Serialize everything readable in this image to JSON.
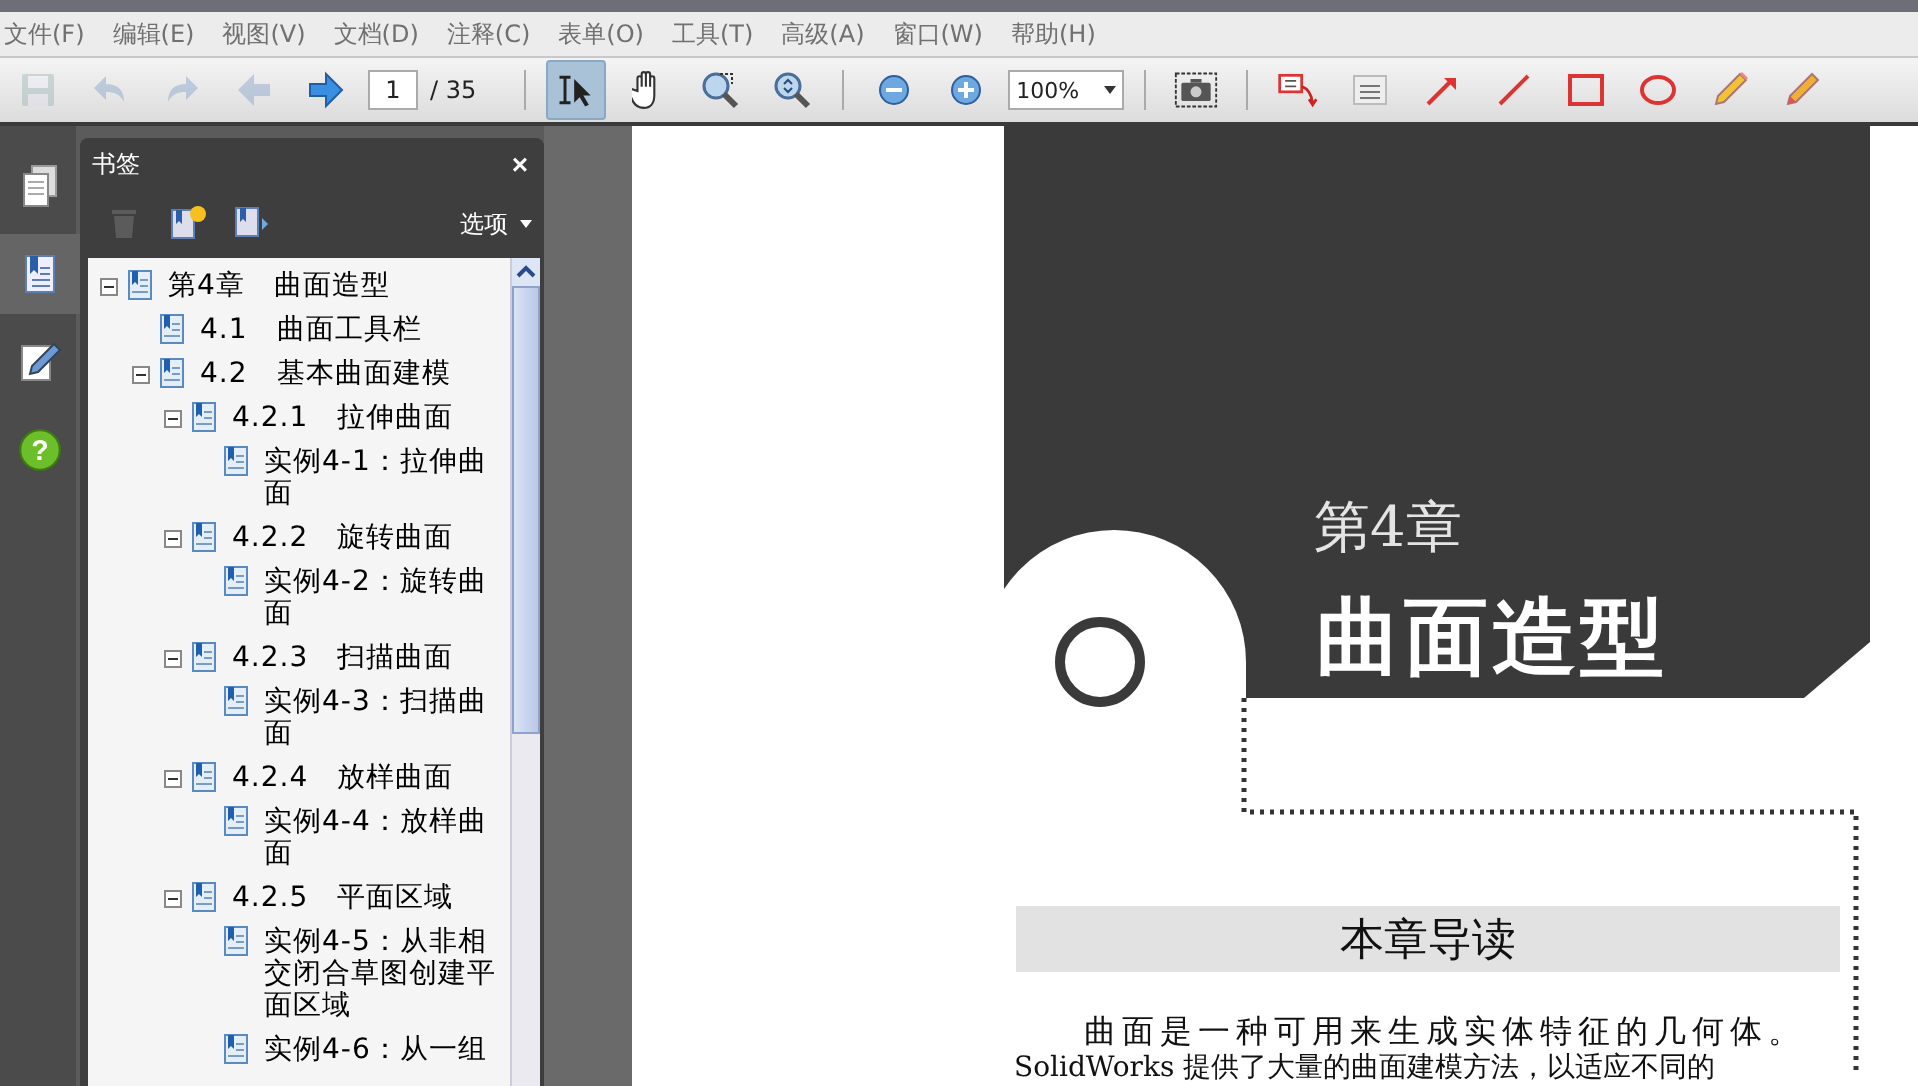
{
  "menu": [
    "文件(F)",
    "编辑(E)",
    "视图(V)",
    "文档(D)",
    "注释(C)",
    "表单(O)",
    "工具(T)",
    "高级(A)",
    "窗口(W)",
    "帮助(H)"
  ],
  "toolbar": {
    "groups": [
      [
        {
          "kind": "save",
          "disabled": true
        },
        {
          "kind": "undo",
          "disabled": true
        },
        {
          "kind": "redo",
          "disabled": true
        },
        {
          "kind": "previous",
          "disabled": true
        },
        {
          "kind": "next",
          "disabled": false
        },
        {
          "kind": "page",
          "value": "1",
          "total": "/ 35"
        }
      ],
      [
        {
          "kind": "select",
          "disabled": false,
          "selected": true
        },
        {
          "kind": "hand",
          "disabled": false,
          "selected": false
        },
        {
          "kind": "marquee",
          "disabled": false,
          "selected": false
        },
        {
          "kind": "zoom",
          "disabled": false,
          "selected": false
        }
      ],
      [
        {
          "kind": "zoomout",
          "disabled": false
        },
        {
          "kind": "zoomin",
          "disabled": false
        },
        {
          "kind": "zoomfield",
          "value": "100%"
        }
      ],
      [
        {
          "kind": "snapshot",
          "disabled": false
        }
      ],
      [
        {
          "kind": "callout",
          "disabled": false,
          "selected": false
        },
        {
          "kind": "textbox",
          "disabled": false,
          "selected": false
        },
        {
          "kind": "arrow",
          "disabled": false,
          "selected": false
        },
        {
          "kind": "line",
          "disabled": false,
          "selected": false
        },
        {
          "kind": "rect",
          "disabled": false,
          "selected": false
        },
        {
          "kind": "ellipse",
          "disabled": false,
          "selected": false
        },
        {
          "kind": "pencil",
          "disabled": false,
          "selected": false
        },
        {
          "kind": "eraser",
          "disabled": false,
          "selected": false
        }
      ]
    ]
  },
  "nav_tabs": [
    {
      "kind": "pages",
      "selected": false
    },
    {
      "kind": "bookmarks",
      "selected": true
    },
    {
      "kind": "sign",
      "selected": false
    },
    {
      "kind": "help",
      "selected": false,
      "symbol": "?"
    }
  ],
  "bookmarks": {
    "title": "书签",
    "close": "×",
    "tools": [
      {
        "kind": "delete",
        "disabled": true
      },
      {
        "kind": "new",
        "disabled": false
      },
      {
        "kind": "expand",
        "disabled": false
      }
    ],
    "options": "选项",
    "tree": [
      {
        "label": "第4章　曲面造型",
        "expanded": true,
        "children": [
          {
            "label": "4.1　曲面工具栏"
          },
          {
            "label": "4.2　基本曲面建模",
            "expanded": true,
            "children": [
              {
                "label": "4.2.1　拉伸曲面",
                "expanded": true,
                "children": [
                  {
                    "label": "实例4-1：拉伸曲面"
                  }
                ]
              },
              {
                "label": "4.2.2　旋转曲面",
                "expanded": true,
                "children": [
                  {
                    "label": "实例4-2：旋转曲面"
                  }
                ]
              },
              {
                "label": "4.2.3　扫描曲面",
                "expanded": true,
                "children": [
                  {
                    "label": "实例4-3：扫描曲面"
                  }
                ]
              },
              {
                "label": "4.2.4　放样曲面",
                "expanded": true,
                "children": [
                  {
                    "label": "实例4-4：放样曲面"
                  }
                ]
              },
              {
                "label": "4.2.5　平面区域",
                "expanded": true,
                "children": [
                  {
                    "label": "实例4-5：从非相交闭合草图创建平面区域"
                  },
                  {
                    "label": "实例4-6：从一组"
                  }
                ]
              }
            ]
          }
        ]
      }
    ]
  },
  "page": {
    "chapter_label": "第4章",
    "chapter_title": "曲面造型",
    "section_heading": "本章导读",
    "paragraph": [
      "曲面是一种可用来生成实体特征的几何体。",
      "SolidWorks 提供了大量的曲面建模方法，以适应不同的"
    ]
  }
}
